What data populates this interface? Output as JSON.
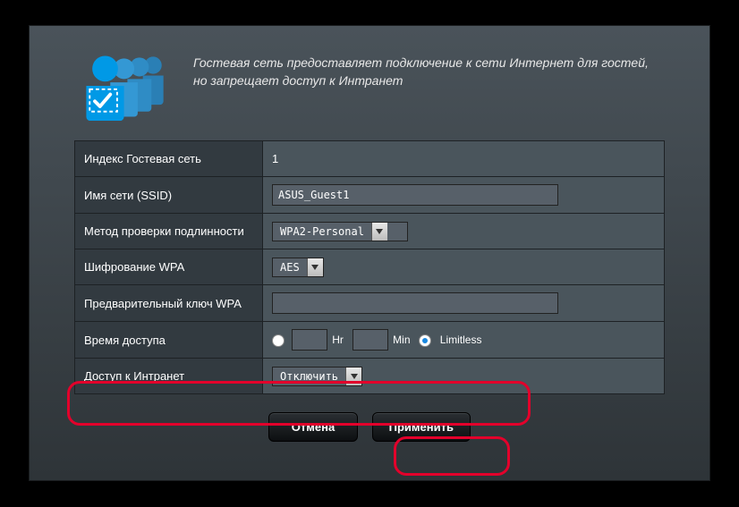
{
  "header": {
    "description": "Гостевая сеть предоставляет подключение к сети Интернет для гостей, но запрещает доступ к Интранет"
  },
  "rows": {
    "index": {
      "label": "Индекс Гостевая сеть",
      "value": "1"
    },
    "ssid": {
      "label": "Имя сети (SSID)",
      "value": "ASUS_Guest1"
    },
    "auth": {
      "label": "Метод проверки подлинности",
      "value": "WPA2-Personal"
    },
    "enc": {
      "label": "Шифрование WPA",
      "value": "AES"
    },
    "psk": {
      "label": "Предварительный ключ WPA",
      "value": ""
    },
    "access_time": {
      "label": "Время доступа",
      "hr": "Hr",
      "min": "Min",
      "limitless": "Limitless"
    },
    "intranet": {
      "label": "Доступ к Интранет",
      "value": "Отключить"
    }
  },
  "buttons": {
    "cancel": "Отмена",
    "apply": "Применить"
  }
}
